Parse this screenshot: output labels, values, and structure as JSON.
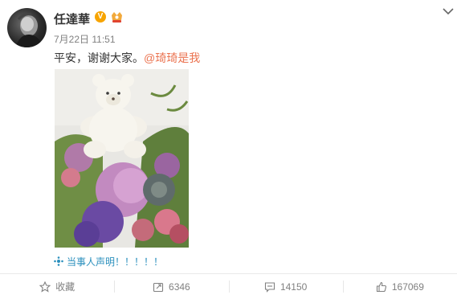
{
  "user": {
    "name": "任達華",
    "verified_badge": "V",
    "avatar_icon": "avatar"
  },
  "post": {
    "timestamp": "7月22日 11:51",
    "text": "平安，谢谢大家。",
    "mention": "@琦琦是我",
    "image": "teddy-bear-flower-bouquet",
    "location_text": "当事人声明！！！！！"
  },
  "actions": {
    "favorite_label": "收藏",
    "repost_count": "6346",
    "comment_count": "14150",
    "like_count": "167069"
  },
  "colors": {
    "mention": "#eb7350",
    "location": "#2a8fbd",
    "meta": "#808080"
  }
}
